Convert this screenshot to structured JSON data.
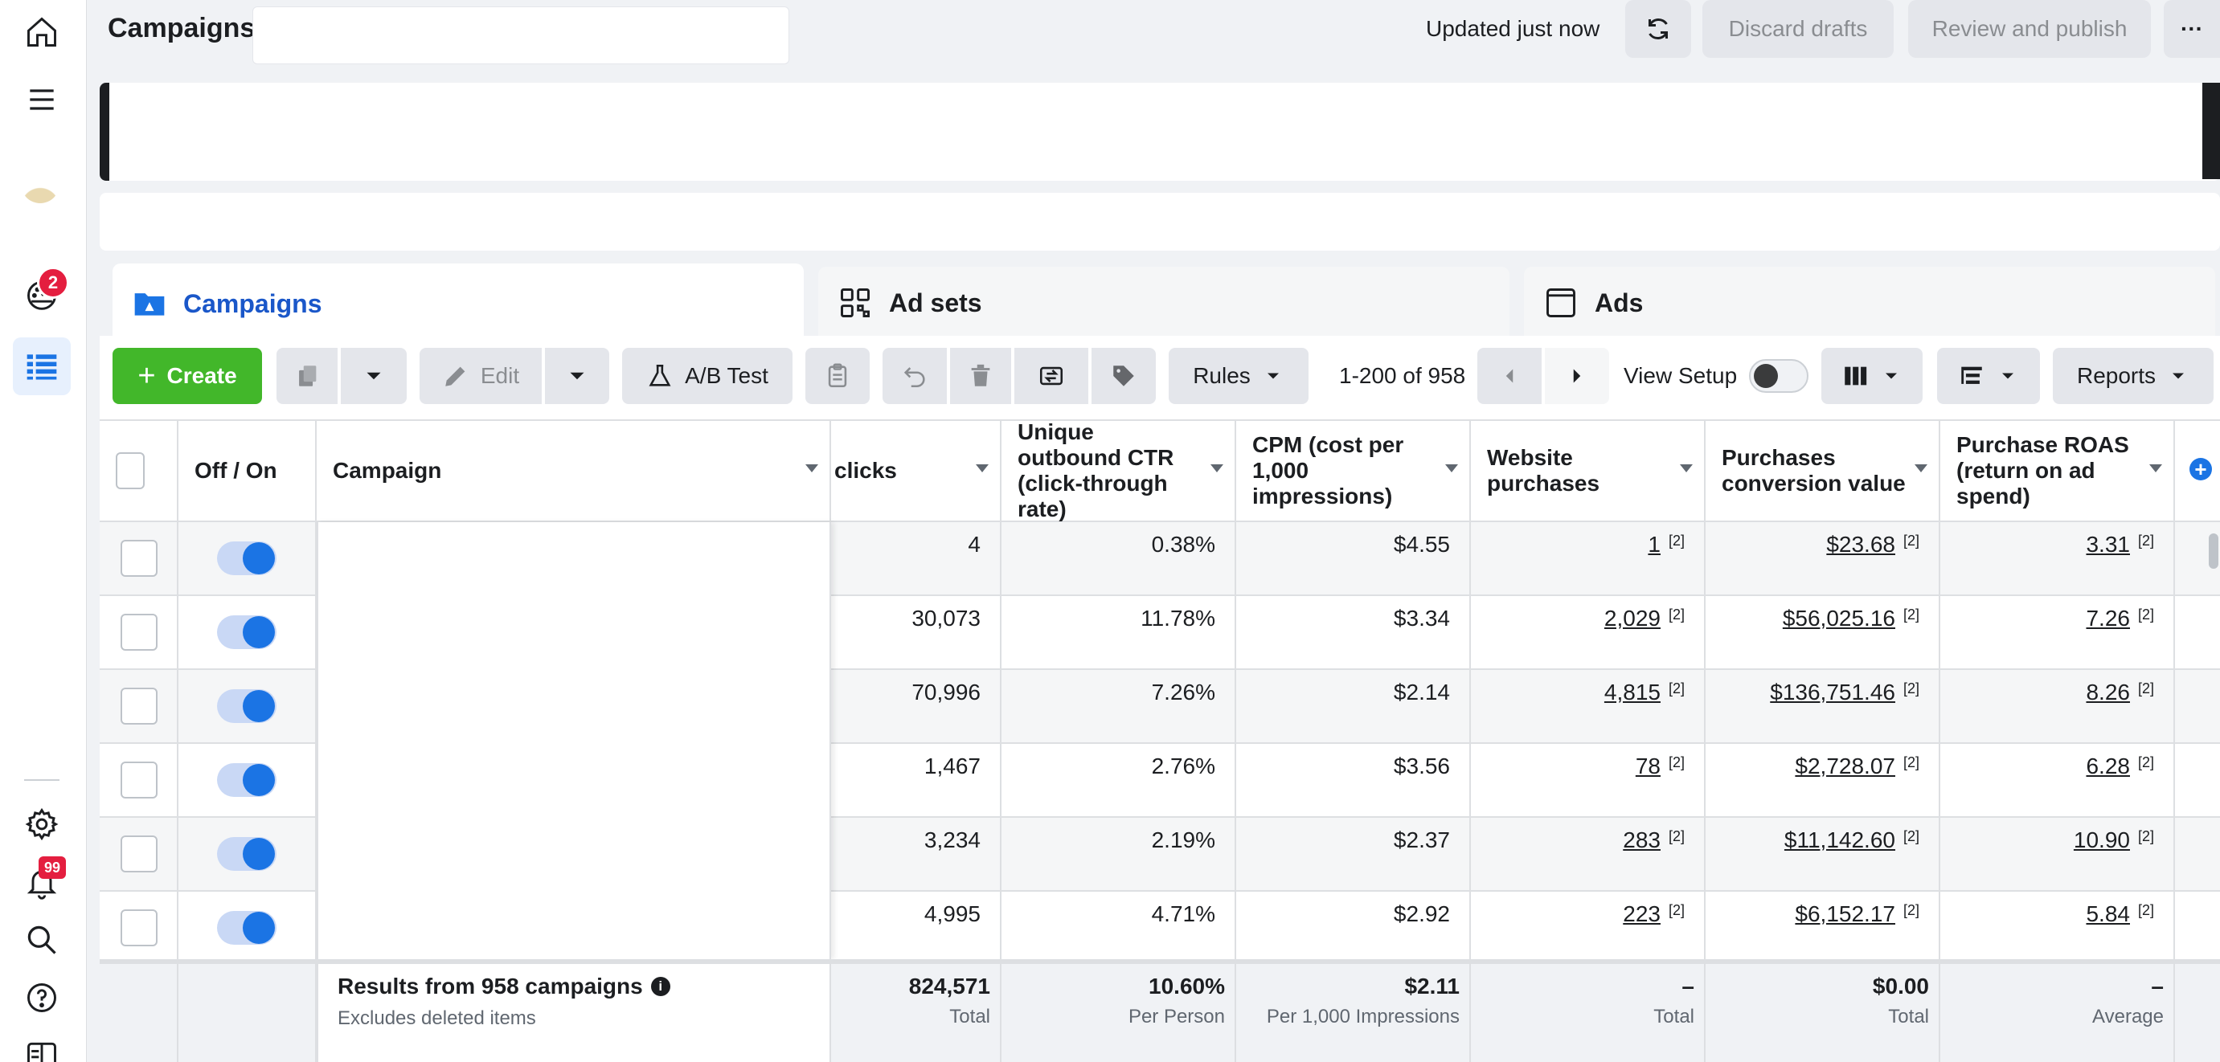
{
  "rail": {
    "gauge_badge": "2",
    "bell_badge": "99"
  },
  "topbar": {
    "title": "Campaigns",
    "updated": "Updated just now",
    "discard": "Discard drafts",
    "review": "Review and publish",
    "more": "···"
  },
  "levels": {
    "campaigns": "Campaigns",
    "adsets": "Ad sets",
    "ads": "Ads"
  },
  "toolbar": {
    "create": "Create",
    "edit": "Edit",
    "ab_test": "A/B Test",
    "rules": "Rules",
    "pager": "1-200 of 958",
    "view_setup": "View Setup",
    "reports": "Reports"
  },
  "table": {
    "headers": {
      "off_on": "Off / On",
      "campaign": "Campaign",
      "clicks": "clicks",
      "ctr": "Unique outbound CTR (click-through rate)",
      "cpm": "CPM (cost per 1,000 impressions)",
      "purchases": "Website purchases",
      "conv_value": "Purchases conversion value",
      "roas": "Purchase ROAS (return on ad spend)"
    },
    "ref_mark": "[2]",
    "rows": [
      {
        "clicks": "4",
        "ctr": "0.38%",
        "cpm": "$4.55",
        "purchases": "1",
        "value": "$23.68",
        "roas": "3.31"
      },
      {
        "clicks": "30,073",
        "ctr": "11.78%",
        "cpm": "$3.34",
        "purchases": "2,029",
        "value": "$56,025.16",
        "roas": "7.26"
      },
      {
        "clicks": "70,996",
        "ctr": "7.26%",
        "cpm": "$2.14",
        "purchases": "4,815",
        "value": "$136,751.46",
        "roas": "8.26"
      },
      {
        "clicks": "1,467",
        "ctr": "2.76%",
        "cpm": "$3.56",
        "purchases": "78",
        "value": "$2,728.07",
        "roas": "6.28"
      },
      {
        "clicks": "3,234",
        "ctr": "2.19%",
        "cpm": "$2.37",
        "purchases": "283",
        "value": "$11,142.60",
        "roas": "10.90"
      },
      {
        "clicks": "4,995",
        "ctr": "4.71%",
        "cpm": "$2.92",
        "purchases": "223",
        "value": "$6,152.17",
        "roas": "5.84"
      }
    ],
    "totals": {
      "results_title": "Results from 958 campaigns",
      "results_sub": "Excludes deleted items",
      "clicks": "824,571",
      "clicks_sub": "Total",
      "ctr": "10.60%",
      "ctr_sub": "Per Person",
      "cpm": "$2.11",
      "cpm_sub": "Per 1,000 Impressions",
      "purchases": "–",
      "purchases_sub": "Total",
      "value": "$0.00",
      "value_sub": "Total",
      "roas": "–",
      "roas_sub": "Average"
    }
  }
}
